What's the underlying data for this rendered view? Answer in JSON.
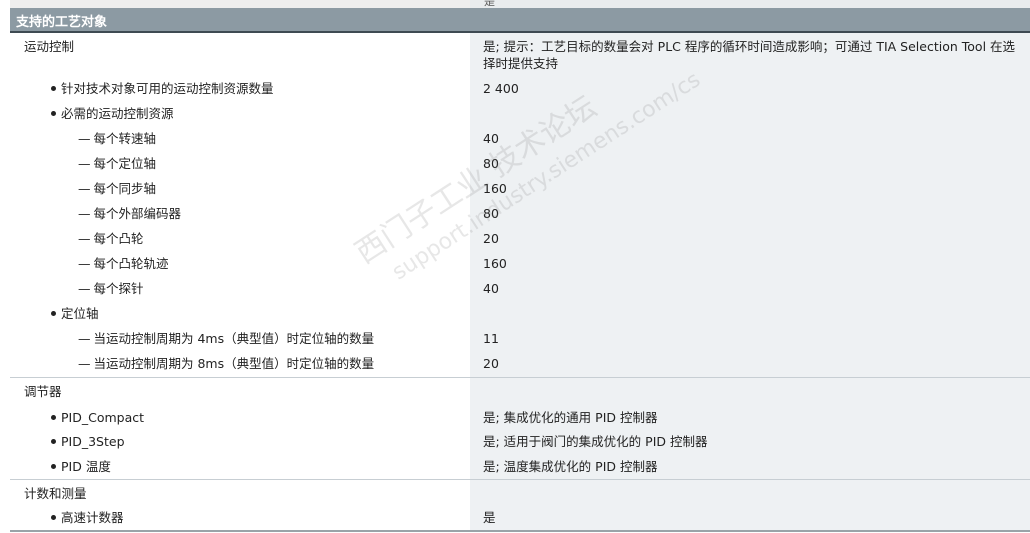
{
  "top_strip": {
    "right_text": "是"
  },
  "section": {
    "title": "支持的工艺对象"
  },
  "rows": [
    {
      "label": "运动控制",
      "value": "是; 提示：工艺目标的数量会对 PLC 程序的循环时间造成影响；可通过 TIA Selection Tool 在选择时提供支持"
    },
    {
      "label": "针对技术对象可用的运动控制资源数量",
      "value": "2 400"
    },
    {
      "label": "必需的运动控制资源",
      "value": ""
    },
    {
      "label": "每个转速轴",
      "value": "40"
    },
    {
      "label": "每个定位轴",
      "value": "80"
    },
    {
      "label": "每个同步轴",
      "value": "160"
    },
    {
      "label": "每个外部编码器",
      "value": "80"
    },
    {
      "label": "每个凸轮",
      "value": "20"
    },
    {
      "label": "每个凸轮轨迹",
      "value": "160"
    },
    {
      "label": "每个探针",
      "value": "40"
    },
    {
      "label": "定位轴",
      "value": ""
    },
    {
      "label": "当运动控制周期为 4ms（典型值）时定位轴的数量",
      "value": "11"
    },
    {
      "label": "当运动控制周期为 8ms（典型值）时定位轴的数量",
      "value": "20"
    },
    {
      "label": "调节器",
      "value": ""
    },
    {
      "label": "PID_Compact",
      "value": "是; 集成优化的通用 PID 控制器"
    },
    {
      "label": "PID_3Step",
      "value": "是; 适用于阀门的集成优化的 PID 控制器"
    },
    {
      "label": "PID 温度",
      "value": "是; 温度集成优化的 PID 控制器"
    },
    {
      "label": "计数和测量",
      "value": ""
    },
    {
      "label": "高速计数器",
      "value": "是"
    }
  ],
  "watermark": {
    "line1": "西门子工业 技术论坛",
    "line2": "support.industry.siemens.com/cs"
  }
}
